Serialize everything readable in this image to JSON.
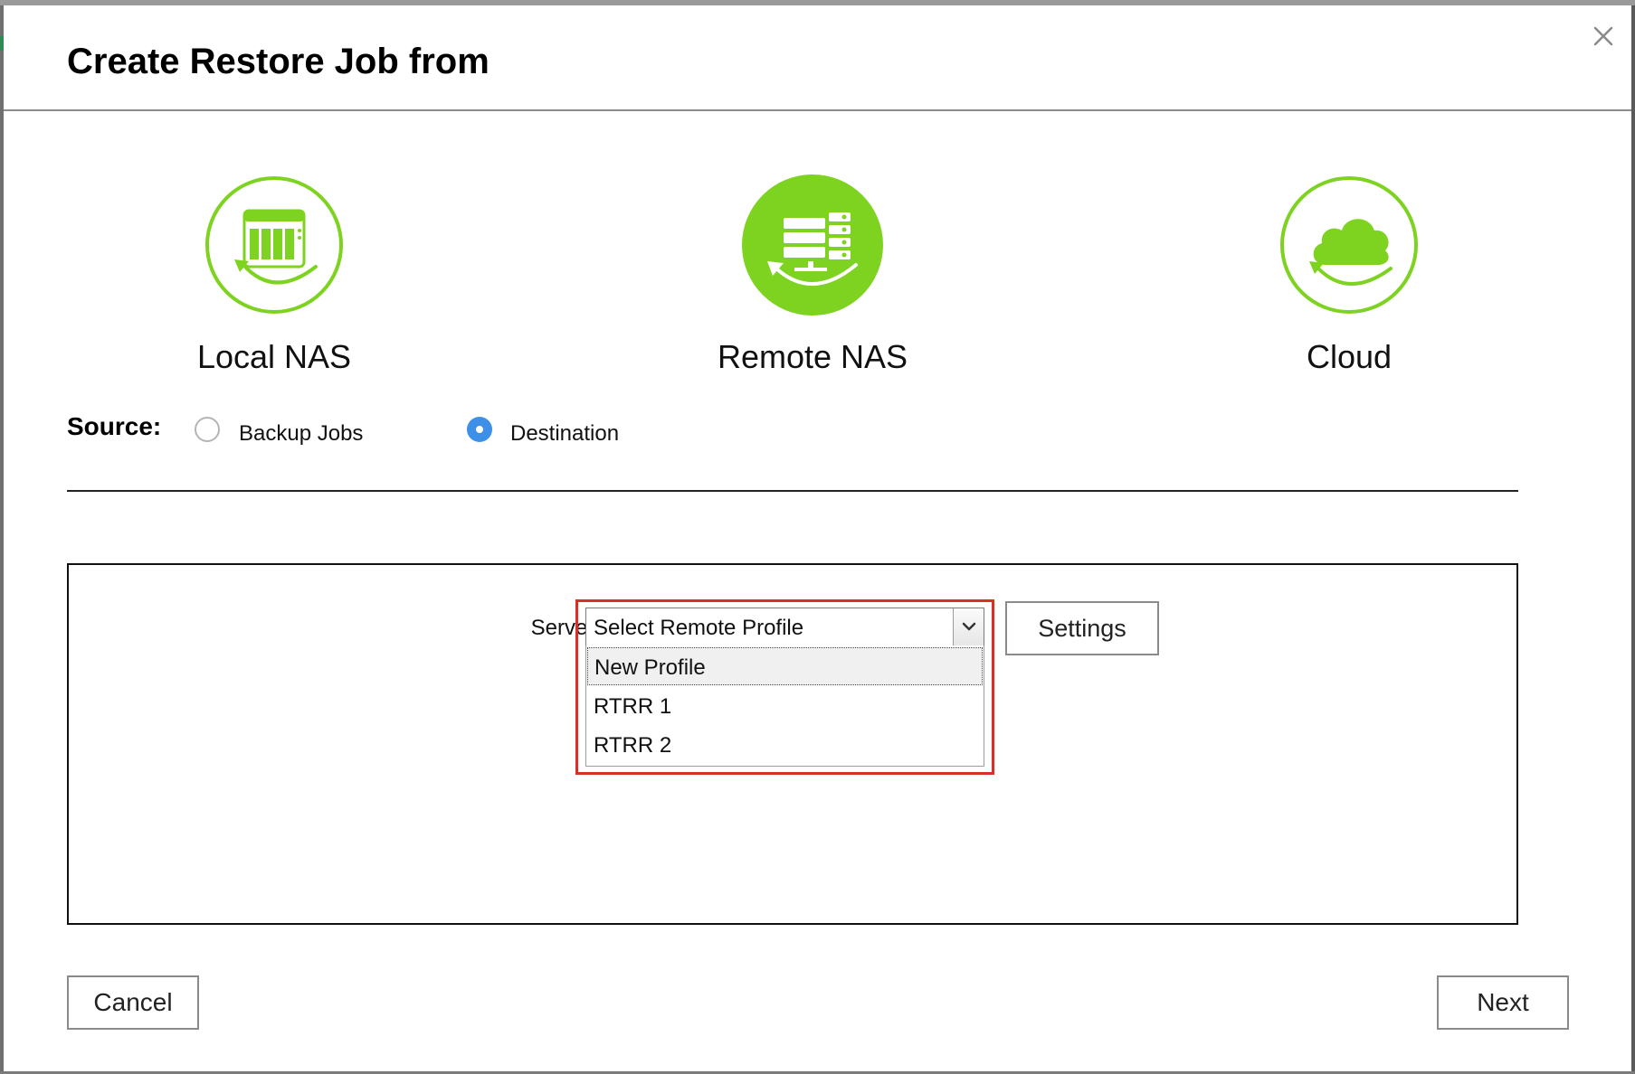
{
  "dialog": {
    "title": "Create Restore Job from",
    "close_icon": "close-icon"
  },
  "sources": [
    {
      "label": "Local NAS",
      "icon": "local-nas-icon",
      "selected": false
    },
    {
      "label": "Remote NAS",
      "icon": "remote-nas-icon",
      "selected": true
    },
    {
      "label": "Cloud",
      "icon": "cloud-icon",
      "selected": false
    }
  ],
  "source_row": {
    "label": "Source:",
    "options": [
      {
        "label": "Backup Jobs",
        "checked": false
      },
      {
        "label": "Destination",
        "checked": true
      }
    ]
  },
  "server": {
    "label": "Server:",
    "selected_value": "Select Remote Profile",
    "options": [
      {
        "label": "New Profile",
        "highlighted": true
      },
      {
        "label": "RTRR 1",
        "highlighted": false
      },
      {
        "label": "RTRR 2",
        "highlighted": false
      }
    ],
    "settings_label": "Settings"
  },
  "footer": {
    "cancel_label": "Cancel",
    "next_label": "Next"
  },
  "colors": {
    "accent_green": "#7ed321",
    "radio_blue": "#3d8fe8",
    "highlight_red": "#d93025"
  }
}
